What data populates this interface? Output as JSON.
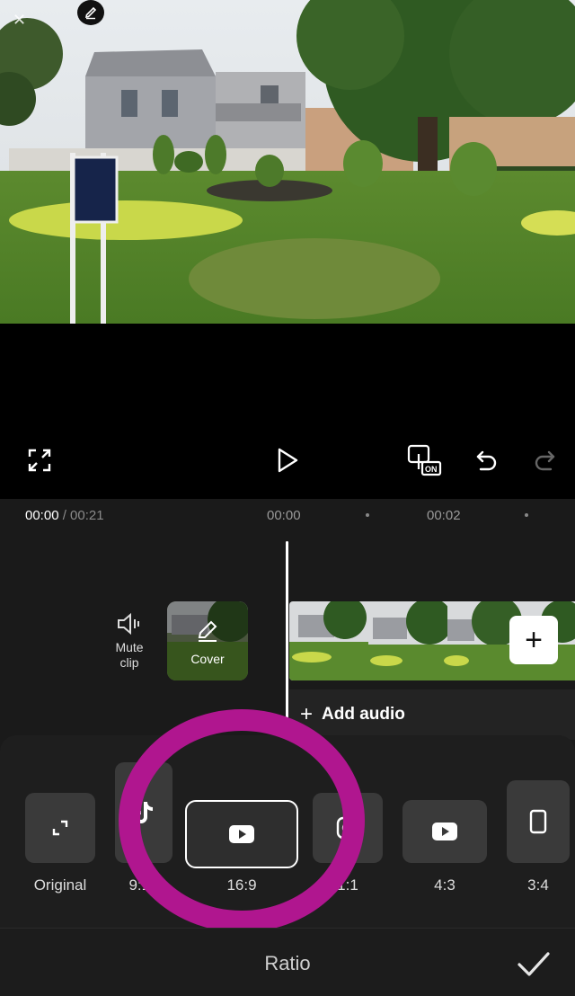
{
  "timeline": {
    "current_time": "00:00",
    "total_time": " / 00:21",
    "ticks": [
      "00:00",
      "00:02"
    ]
  },
  "clip_tools": {
    "mute_label": "Mute clip",
    "cover_label": "Cover"
  },
  "audio": {
    "add_audio_label": "Add audio"
  },
  "ratio": {
    "title": "Ratio",
    "selected": "16:9",
    "options": [
      {
        "label": "Original",
        "icon": "expand-corners-icon"
      },
      {
        "label": "9:16",
        "icon": "tiktok-icon"
      },
      {
        "label": "16:9",
        "icon": "youtube-icon"
      },
      {
        "label": "1:1",
        "icon": "instagram-icon"
      },
      {
        "label": "4:3",
        "icon": "youtube-icon"
      },
      {
        "label": "3:4",
        "icon": "phone-icon"
      }
    ]
  },
  "colors": {
    "annotation": "#b0168f",
    "panel_bg": "#1e1e1e",
    "tile_bg": "#3a3a3a"
  }
}
